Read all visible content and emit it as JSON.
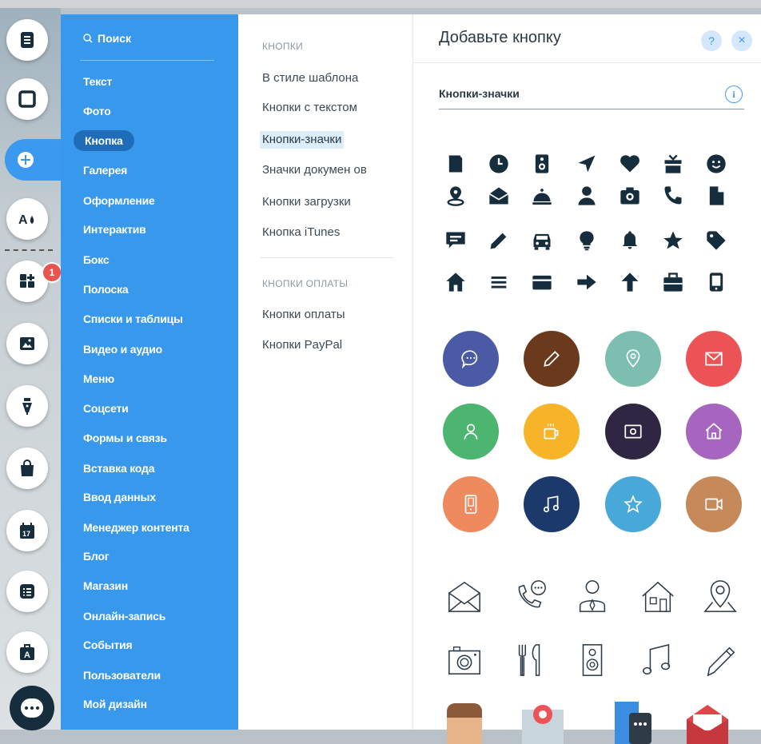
{
  "left_rail": {
    "badge_count": "1"
  },
  "categories": {
    "search_label": "Поиск",
    "items": [
      "Текст",
      "Фото",
      "Кнопка",
      "Галерея",
      "Оформление",
      "Интерактив",
      "Бокс",
      "Полоска",
      "Списки и таблицы",
      "Видео и аудио",
      "Меню",
      "Соцсети",
      "Формы и связь",
      "Вставка кода",
      "Ввод данных",
      "Менеджер контента",
      "Блог",
      "Магазин",
      "Онлайн-запись",
      "События",
      "Пользователи",
      "Мой дизайн"
    ],
    "selected": "Кнопка"
  },
  "submenu": {
    "heading_buttons": "КНОПКИ",
    "items_buttons": [
      "В стиле шаблона",
      "Кнопки с текстом",
      "Кнопки-значки",
      "Значки докумен ов",
      "Кнопки загрузки",
      "Кнопка iTunes"
    ],
    "selected": "Кнопки-значки",
    "heading_payment": "КНОПКИ ОПЛАТЫ",
    "items_payment": [
      "Кнопки оплаты",
      "Кнопки PayPal"
    ]
  },
  "panel": {
    "title": "Добавьте кнопку",
    "help": "?",
    "close": "×",
    "section_title": "Кнопки-значки",
    "info": "i"
  },
  "solid_icons": [
    "document-icon",
    "clock-icon",
    "speaker-icon",
    "send-icon",
    "heart-icon",
    "gift-icon",
    "smiley-icon",
    "location-pin-icon",
    "envelope-open-icon",
    "cloche-icon",
    "user-icon",
    "camera-icon",
    "phone-icon",
    "file-icon",
    "comment-icon",
    "pencil-icon",
    "car-icon",
    "lightbulb-icon",
    "bell-icon",
    "star-icon",
    "tag-icon",
    "home-icon",
    "menu-icon",
    "credit-card-icon",
    "arrow-right-icon",
    "arrow-up-icon",
    "briefcase-icon",
    "mobile-icon"
  ],
  "circle_icons": [
    {
      "icon": "chat-icon",
      "color": "#4b5aa5"
    },
    {
      "icon": "pencil-icon",
      "color": "#6b3a1d"
    },
    {
      "icon": "location-icon",
      "color": "#7cbfb0"
    },
    {
      "icon": "mail-icon",
      "color": "#ec5356"
    },
    {
      "icon": "user-icon",
      "color": "#4cb56f"
    },
    {
      "icon": "coffee-icon",
      "color": "#f7b429"
    },
    {
      "icon": "photo-icon",
      "color": "#2f2644"
    },
    {
      "icon": "home-icon",
      "color": "#a665bf"
    },
    {
      "icon": "phone-icon",
      "color": "#ee8a5d"
    },
    {
      "icon": "music-icon",
      "color": "#1b3a6b"
    },
    {
      "icon": "star-icon",
      "color": "#48a9d9"
    },
    {
      "icon": "video-icon",
      "color": "#c6895a"
    }
  ],
  "line_icons": [
    "envelope-icon",
    "phone-call-icon",
    "user-tie-icon",
    "house-icon",
    "map-pin-icon",
    "camera-icon",
    "cutlery-icon",
    "speaker-icon",
    "music-note-icon",
    "pencil-icon"
  ],
  "image_icons": [
    "person-icon",
    "map-icon",
    "chat-window-icon",
    "mail-icon"
  ]
}
